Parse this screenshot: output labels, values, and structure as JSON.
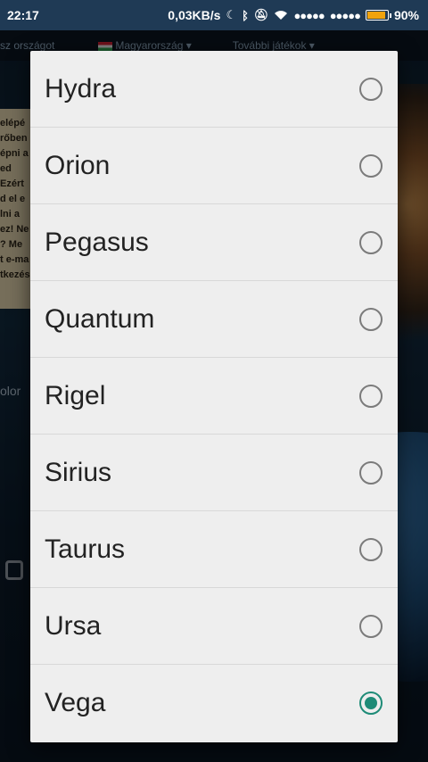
{
  "status_bar": {
    "time": "22:17",
    "speed": "0,03KB/s",
    "battery": "90%",
    "battery_level": 0.9,
    "icons": [
      "moon-icon",
      "bluetooth-icon",
      "bell-off-icon",
      "wifi-icon",
      "signal-icon",
      "signal-icon",
      "battery-icon"
    ]
  },
  "background": {
    "topbar_country_label": "sz országot",
    "topbar_country_value": "Magyarország",
    "topbar_more_games": "További játékok",
    "textbox_lines": [
      "elépé",
      "rőben",
      "épni a",
      "ed",
      "Ezért",
      "d el e",
      "lni a",
      "ez! Ne",
      "? Me",
      "t e-ma",
      "tkezés"
    ],
    "side_label": "olor"
  },
  "dialog": {
    "options": [
      {
        "label": "Hydra",
        "checked": false
      },
      {
        "label": "Orion",
        "checked": false
      },
      {
        "label": "Pegasus",
        "checked": false
      },
      {
        "label": "Quantum",
        "checked": false
      },
      {
        "label": "Rigel",
        "checked": false
      },
      {
        "label": "Sirius",
        "checked": false
      },
      {
        "label": "Taurus",
        "checked": false
      },
      {
        "label": "Ursa",
        "checked": false
      },
      {
        "label": "Vega",
        "checked": true
      }
    ],
    "accent_color": "#1e8b77"
  }
}
